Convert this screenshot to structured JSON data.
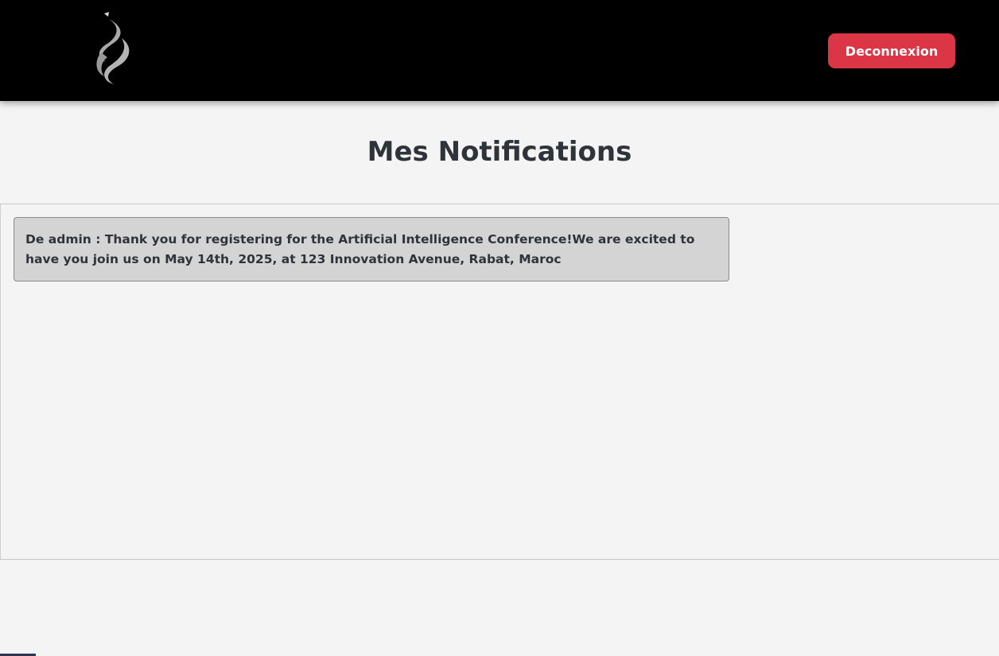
{
  "header": {
    "logo_icon": "flame-logo-icon",
    "logout_label": "Deconnexion",
    "colors": {
      "background": "#000000",
      "logout_button": "#dc3545"
    }
  },
  "main": {
    "title": "Mes Notifications",
    "notifications": [
      {
        "text": "De admin : Thank you for registering for the Artificial Intelligence Conference!We are excited to have you join us on May 14th, 2025, at 123 Innovation Avenue, Rabat, Maroc"
      }
    ]
  }
}
